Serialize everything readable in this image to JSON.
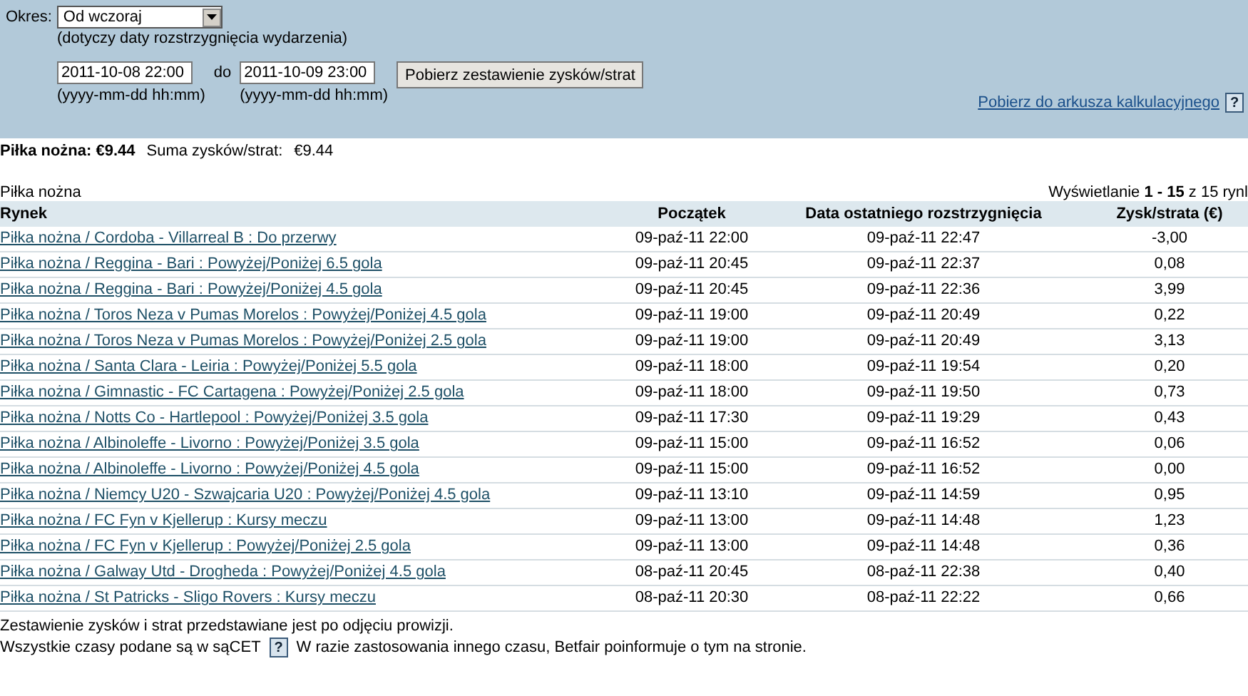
{
  "filter": {
    "period_label": "Okres:",
    "period_value": "Od wczoraj",
    "period_note": "(dotyczy daty rozstrzygnięcia wydarzenia)",
    "from_value": "2011-10-08 22:00",
    "from_hint": "(yyyy-mm-dd hh:mm)",
    "to_label": "do",
    "to_value": "2011-10-09 23:00",
    "to_hint": "(yyyy-mm-dd hh:mm)",
    "submit": "Pobierz zestawienie zysków/strat",
    "export_link": "Pobierz do arkusza kalkulacyjnego",
    "help": "?"
  },
  "summary": {
    "sport_total": "Piłka nożna: €9.44",
    "sum_label": "Suma zysków/strat:",
    "sum_value": "€9.44"
  },
  "section_title": "Piłka nożna",
  "paging": "Wyświetlanie **1 - 15** z 15 rynl",
  "table": {
    "columns": [
      "Rynek",
      "Początek",
      "Data ostatniego rozstrzygnięcia",
      "Zysk/strata (€)"
    ],
    "rows": [
      [
        "Piłka nożna / Cordoba - Villarreal B : Do przerwy",
        "09-paź-11 22:00",
        "09-paź-11 22:47",
        "-3,00"
      ],
      [
        "Piłka nożna / Reggina - Bari : Powyżej/Poniżej 6.5 gola",
        "09-paź-11 20:45",
        "09-paź-11 22:37",
        "0,08"
      ],
      [
        "Piłka nożna / Reggina - Bari : Powyżej/Poniżej 4.5 gola",
        "09-paź-11 20:45",
        "09-paź-11 22:36",
        "3,99"
      ],
      [
        "Piłka nożna / Toros Neza v Pumas Morelos : Powyżej/Poniżej 4.5 gola",
        "09-paź-11 19:00",
        "09-paź-11 20:49",
        "0,22"
      ],
      [
        "Piłka nożna / Toros Neza v Pumas Morelos : Powyżej/Poniżej 2.5 gola",
        "09-paź-11 19:00",
        "09-paź-11 20:49",
        "3,13"
      ],
      [
        "Piłka nożna / Santa Clara - Leiria : Powyżej/Poniżej 5.5 gola",
        "09-paź-11 18:00",
        "09-paź-11 19:54",
        "0,20"
      ],
      [
        "Piłka nożna / Gimnastic - FC Cartagena : Powyżej/Poniżej 2.5 gola",
        "09-paź-11 18:00",
        "09-paź-11 19:50",
        "0,73"
      ],
      [
        "Piłka nożna / Notts Co - Hartlepool : Powyżej/Poniżej 3.5 gola",
        "09-paź-11 17:30",
        "09-paź-11 19:29",
        "0,43"
      ],
      [
        "Piłka nożna / Albinoleffe - Livorno : Powyżej/Poniżej 3.5 gola",
        "09-paź-11 15:00",
        "09-paź-11 16:52",
        "0,06"
      ],
      [
        "Piłka nożna / Albinoleffe - Livorno : Powyżej/Poniżej 4.5 gola",
        "09-paź-11 15:00",
        "09-paź-11 16:52",
        "0,00"
      ],
      [
        "Piłka nożna / Niemcy U20 - Szwajcaria U20 : Powyżej/Poniżej 4.5 gola",
        "09-paź-11 13:10",
        "09-paź-11 14:59",
        "0,95"
      ],
      [
        "Piłka nożna / FC Fyn v Kjellerup : Kursy meczu",
        "09-paź-11 13:00",
        "09-paź-11 14:48",
        "1,23"
      ],
      [
        "Piłka nożna / FC Fyn v Kjellerup : Powyżej/Poniżej 2.5 gola",
        "09-paź-11 13:00",
        "09-paź-11 14:48",
        "0,36"
      ],
      [
        "Piłka nożna / Galway Utd - Drogheda : Powyżej/Poniżej 4.5 gola",
        "08-paź-11 20:45",
        "08-paź-11 22:38",
        "0,40"
      ],
      [
        "Piłka nożna / St Patricks - Sligo Rovers : Kursy meczu",
        "08-paź-11 20:30",
        "08-paź-11 22:22",
        "0,66"
      ]
    ]
  },
  "footer": {
    "line1": "Zestawienie zysków i strat przedstawiane jest po odjęciu prowizji.",
    "line2_before": "Wszystkie czasy podane są w sąCET",
    "help": "?",
    "line2_after": "W razie zastosowania innego czasu, Betfair poinformuje o tym na stronie."
  }
}
